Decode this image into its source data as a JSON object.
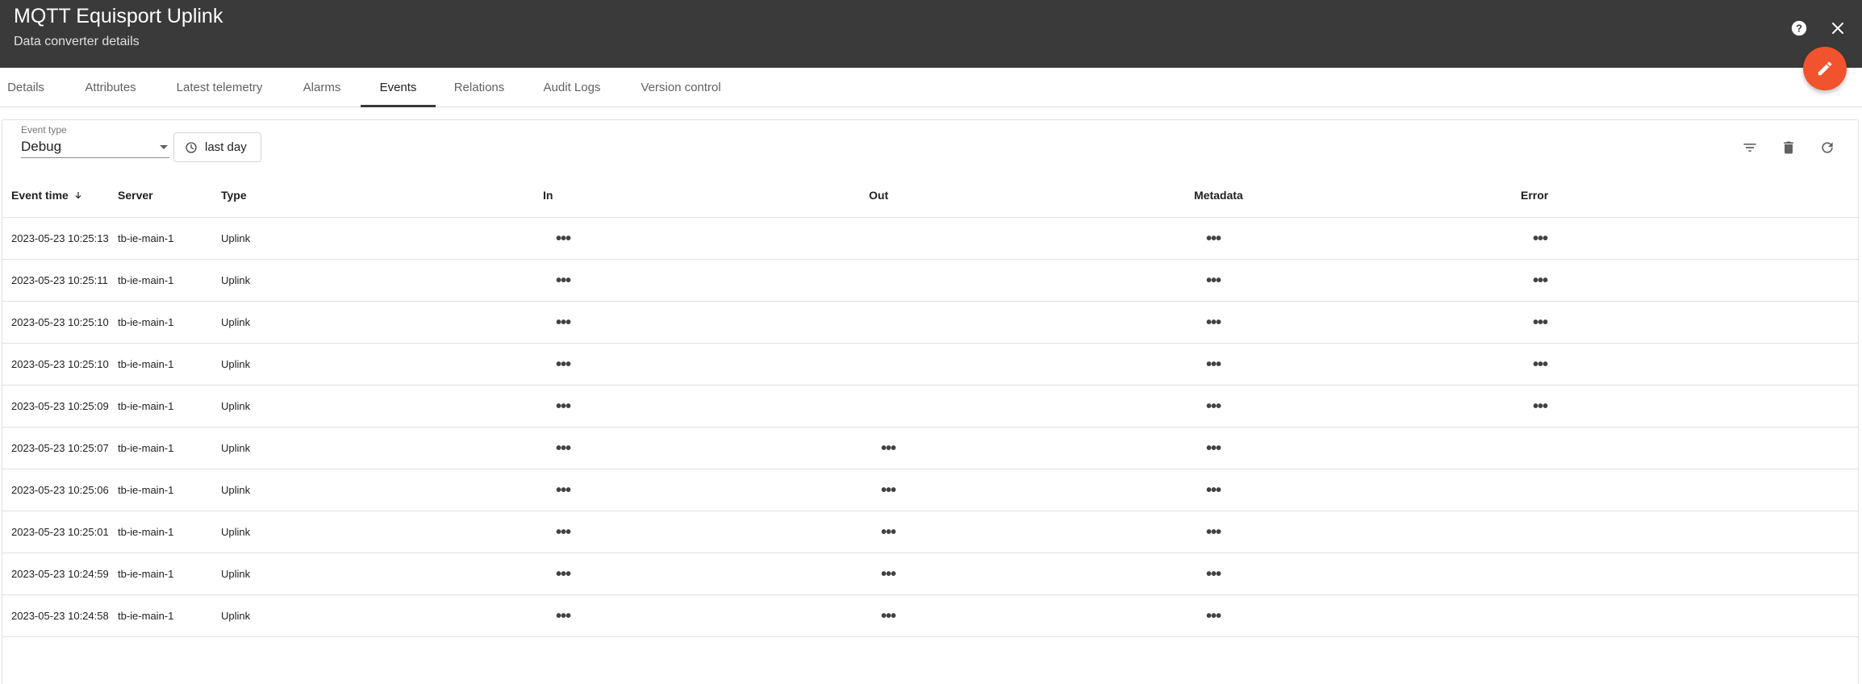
{
  "header": {
    "title": "MQTT Equisport Uplink",
    "subtitle": "Data converter details",
    "help_icon": "help-circle-icon",
    "close_icon": "close-icon"
  },
  "fab": {
    "icon": "edit-pencil-icon",
    "color": "#f0532d"
  },
  "tabs": [
    {
      "label": "Details"
    },
    {
      "label": "Attributes"
    },
    {
      "label": "Latest telemetry"
    },
    {
      "label": "Alarms"
    },
    {
      "label": "Events"
    },
    {
      "label": "Relations"
    },
    {
      "label": "Audit Logs"
    },
    {
      "label": "Version control"
    }
  ],
  "active_tab": "Events",
  "filters": {
    "event_type_label": "Event type",
    "event_type_value": "Debug",
    "time_window": "last day"
  },
  "toolbar": {
    "filter_icon": "filter-list-icon",
    "delete_icon": "delete-icon",
    "refresh_icon": "refresh-icon"
  },
  "table": {
    "columns": [
      "Event time",
      "Server",
      "Type",
      "In",
      "Out",
      "Metadata",
      "Error"
    ],
    "sort_icon": "arrow-down-icon",
    "ellipsis": "•••",
    "rows": [
      {
        "time": "2023-05-23 10:25:13",
        "server": "tb-ie-main-1",
        "type": "Uplink",
        "in": true,
        "out": false,
        "metadata": true,
        "error": true
      },
      {
        "time": "2023-05-23 10:25:11",
        "server": "tb-ie-main-1",
        "type": "Uplink",
        "in": true,
        "out": false,
        "metadata": true,
        "error": true
      },
      {
        "time": "2023-05-23 10:25:10",
        "server": "tb-ie-main-1",
        "type": "Uplink",
        "in": true,
        "out": false,
        "metadata": true,
        "error": true
      },
      {
        "time": "2023-05-23 10:25:10",
        "server": "tb-ie-main-1",
        "type": "Uplink",
        "in": true,
        "out": false,
        "metadata": true,
        "error": true
      },
      {
        "time": "2023-05-23 10:25:09",
        "server": "tb-ie-main-1",
        "type": "Uplink",
        "in": true,
        "out": false,
        "metadata": true,
        "error": true
      },
      {
        "time": "2023-05-23 10:25:07",
        "server": "tb-ie-main-1",
        "type": "Uplink",
        "in": true,
        "out": true,
        "metadata": true,
        "error": false
      },
      {
        "time": "2023-05-23 10:25:06",
        "server": "tb-ie-main-1",
        "type": "Uplink",
        "in": true,
        "out": true,
        "metadata": true,
        "error": false
      },
      {
        "time": "2023-05-23 10:25:01",
        "server": "tb-ie-main-1",
        "type": "Uplink",
        "in": true,
        "out": true,
        "metadata": true,
        "error": false
      },
      {
        "time": "2023-05-23 10:24:59",
        "server": "tb-ie-main-1",
        "type": "Uplink",
        "in": true,
        "out": true,
        "metadata": true,
        "error": false
      },
      {
        "time": "2023-05-23 10:24:58",
        "server": "tb-ie-main-1",
        "type": "Uplink",
        "in": true,
        "out": true,
        "metadata": true,
        "error": false
      }
    ]
  }
}
